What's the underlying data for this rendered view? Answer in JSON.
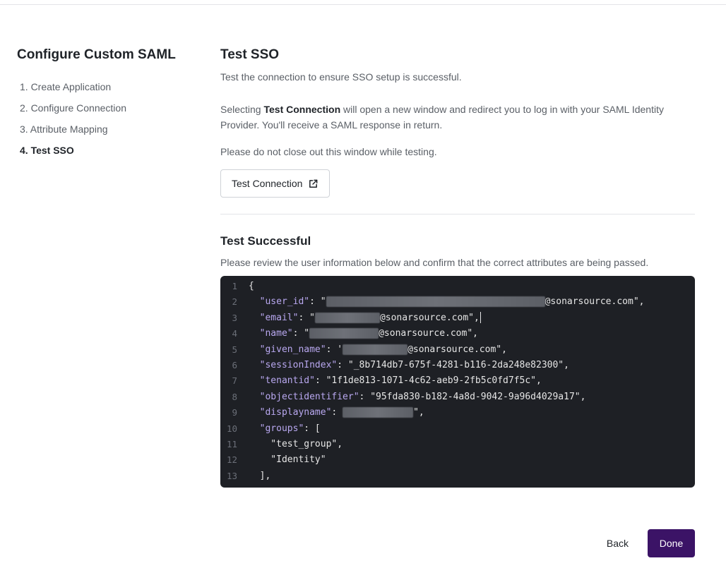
{
  "sidebar": {
    "title": "Configure Custom SAML",
    "steps": [
      {
        "label": "1. Create Application"
      },
      {
        "label": "2. Configure Connection"
      },
      {
        "label": "3. Attribute Mapping"
      },
      {
        "label": "4. Test SSO"
      }
    ]
  },
  "main": {
    "title": "Test SSO",
    "intro": "Test the connection to ensure SSO setup is successful.",
    "selecting_pre": "Selecting ",
    "selecting_bold": "Test Connection",
    "selecting_post": " will open a new window and redirect you to log in with your SAML Identity Provider. You'll receive a SAML response in return.",
    "warning": "Please do not close out this window while testing.",
    "test_button_label": "Test Connection",
    "result_title": "Test Successful",
    "result_desc": "Please review the user information below and confirm that the correct attributes are being passed."
  },
  "code": {
    "lines": [
      {
        "n": "1",
        "parts": [
          {
            "t": "p",
            "v": "{"
          }
        ]
      },
      {
        "n": "2",
        "parts": [
          {
            "t": "p",
            "v": "  "
          },
          {
            "t": "k",
            "v": "\"user_id\""
          },
          {
            "t": "p",
            "v": ": \""
          },
          {
            "t": "r",
            "w": 310
          },
          {
            "t": "s",
            "v": "@sonarsource.com\","
          }
        ]
      },
      {
        "n": "3",
        "parts": [
          {
            "t": "p",
            "v": "  "
          },
          {
            "t": "k",
            "v": "\"email\""
          },
          {
            "t": "p",
            "v": ": \""
          },
          {
            "t": "r",
            "w": 92
          },
          {
            "t": "s",
            "v": "@sonarsource.com\","
          },
          {
            "t": "c"
          }
        ]
      },
      {
        "n": "4",
        "parts": [
          {
            "t": "p",
            "v": "  "
          },
          {
            "t": "k",
            "v": "\"name\""
          },
          {
            "t": "p",
            "v": ": \""
          },
          {
            "t": "r",
            "w": 98
          },
          {
            "t": "s",
            "v": "@sonarsource.com\","
          }
        ]
      },
      {
        "n": "5",
        "parts": [
          {
            "t": "p",
            "v": "  "
          },
          {
            "t": "k",
            "v": "\"given_name\""
          },
          {
            "t": "p",
            "v": ": '"
          },
          {
            "t": "r",
            "w": 92
          },
          {
            "t": "s",
            "v": "@sonarsource.com\","
          }
        ]
      },
      {
        "n": "6",
        "parts": [
          {
            "t": "p",
            "v": "  "
          },
          {
            "t": "k",
            "v": "\"sessionIndex\""
          },
          {
            "t": "p",
            "v": ": "
          },
          {
            "t": "s",
            "v": "\"_8b714db7-675f-4281-b116-2da248e82300\","
          }
        ]
      },
      {
        "n": "7",
        "parts": [
          {
            "t": "p",
            "v": "  "
          },
          {
            "t": "k",
            "v": "\"tenantid\""
          },
          {
            "t": "p",
            "v": ": "
          },
          {
            "t": "s",
            "v": "\"1f1de813-1071-4c62-aeb9-2fb5c0fd7f5c\","
          }
        ]
      },
      {
        "n": "8",
        "parts": [
          {
            "t": "p",
            "v": "  "
          },
          {
            "t": "k",
            "v": "\"objectidentifier\""
          },
          {
            "t": "p",
            "v": ": "
          },
          {
            "t": "s",
            "v": "\"95fda830-b182-4a8d-9042-9a96d4029a17\","
          }
        ]
      },
      {
        "n": "9",
        "parts": [
          {
            "t": "p",
            "v": "  "
          },
          {
            "t": "k",
            "v": "\"displayname\""
          },
          {
            "t": "p",
            "v": ": "
          },
          {
            "t": "r",
            "w": 100
          },
          {
            "t": "s",
            "v": "\","
          }
        ]
      },
      {
        "n": "10",
        "parts": [
          {
            "t": "p",
            "v": "  "
          },
          {
            "t": "k",
            "v": "\"groups\""
          },
          {
            "t": "p",
            "v": ": ["
          }
        ]
      },
      {
        "n": "11",
        "parts": [
          {
            "t": "s",
            "v": "    \"test_group\","
          }
        ]
      },
      {
        "n": "12",
        "parts": [
          {
            "t": "s",
            "v": "    \"Identity\""
          }
        ]
      },
      {
        "n": "13",
        "parts": [
          {
            "t": "p",
            "v": "  ],"
          }
        ]
      }
    ]
  },
  "footer": {
    "back_label": "Back",
    "done_label": "Done"
  },
  "colors": {
    "primary": "#3b1366",
    "code_bg": "#1e2025",
    "code_key": "#b9a8f0"
  }
}
